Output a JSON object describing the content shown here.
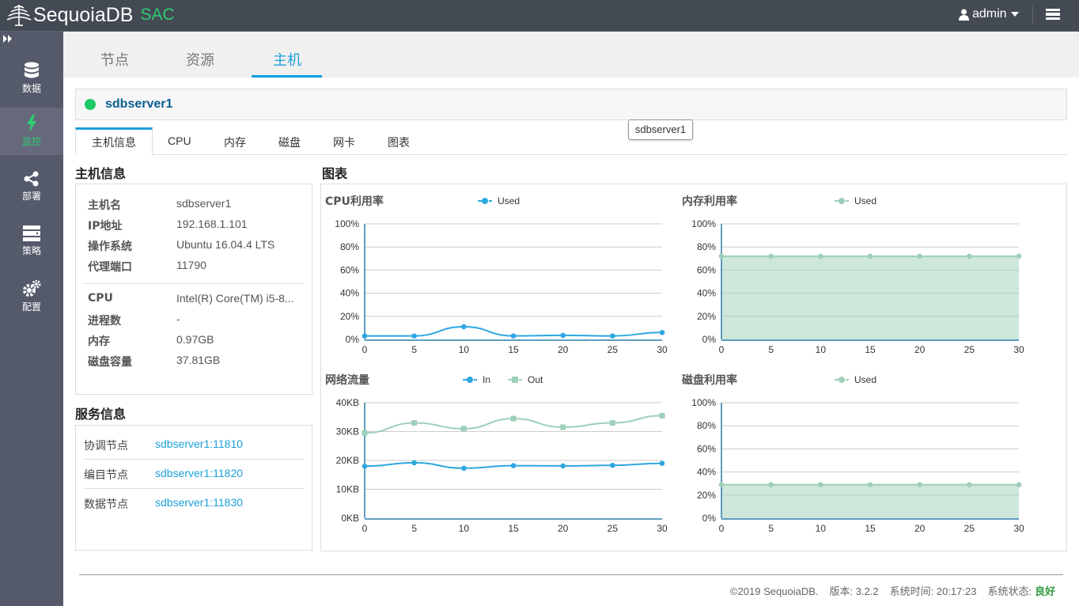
{
  "app": {
    "brand": "SequoiaDB",
    "suffix": "SAC",
    "user": "admin"
  },
  "sidebar": {
    "items": [
      {
        "label": "数据",
        "icon": "database-icon"
      },
      {
        "label": "监控",
        "icon": "bolt-icon"
      },
      {
        "label": "部署",
        "icon": "share-icon"
      },
      {
        "label": "策略",
        "icon": "server-icon"
      },
      {
        "label": "配置",
        "icon": "gears-icon"
      }
    ]
  },
  "page_tabs": [
    "节点",
    "资源",
    "主机"
  ],
  "host": {
    "name": "sdbserver1",
    "tooltip": "sdbserver1",
    "status_color": "#1ec964"
  },
  "sub_tabs": [
    "主机信息",
    "CPU",
    "内存",
    "磁盘",
    "网卡",
    "图表"
  ],
  "host_info": {
    "title": "主机信息",
    "rows1": [
      {
        "k": "主机名",
        "v": "sdbserver1"
      },
      {
        "k": "IP地址",
        "v": "192.168.1.101"
      },
      {
        "k": "操作系统",
        "v": "Ubuntu 16.04.4 LTS"
      },
      {
        "k": "代理端口",
        "v": "11790"
      }
    ],
    "rows2": [
      {
        "k": "CPU",
        "v": "Intel(R) Core(TM) i5-8..."
      },
      {
        "k": "进程数",
        "v": "-"
      },
      {
        "k": "内存",
        "v": "0.97GB"
      },
      {
        "k": "磁盘容量",
        "v": "37.81GB"
      }
    ]
  },
  "service_info": {
    "title": "服务信息",
    "rows": [
      {
        "k": "协调节点",
        "v": "sdbserver1:11810"
      },
      {
        "k": "编目节点",
        "v": "sdbserver1:11820"
      },
      {
        "k": "数据节点",
        "v": "sdbserver1:11830"
      }
    ]
  },
  "charts_title": "图表",
  "chart_data": [
    {
      "type": "line",
      "title": "CPU利用率",
      "x": [
        0,
        5,
        10,
        15,
        20,
        25,
        30
      ],
      "yticks": [
        "0%",
        "20%",
        "40%",
        "60%",
        "80%",
        "100%"
      ],
      "ylim": [
        0,
        100
      ],
      "series": [
        {
          "name": "Used",
          "values": [
            3,
            3,
            11,
            3,
            3.5,
            3,
            6
          ],
          "color": "#2ea7e0",
          "marker": "circle",
          "fill": false
        }
      ]
    },
    {
      "type": "area",
      "title": "内存利用率",
      "x": [
        0,
        5,
        10,
        15,
        20,
        25,
        30
      ],
      "yticks": [
        "0%",
        "20%",
        "40%",
        "60%",
        "80%",
        "100%"
      ],
      "ylim": [
        0,
        100
      ],
      "series": [
        {
          "name": "Used",
          "values": [
            72,
            72,
            72,
            72,
            72,
            72,
            72
          ],
          "color": "#9ecfb8",
          "marker": "circle",
          "fill": true
        }
      ]
    },
    {
      "type": "line",
      "title": "网络流量",
      "x": [
        0,
        5,
        10,
        15,
        20,
        25,
        30
      ],
      "yticks": [
        "0KB",
        "10KB",
        "20KB",
        "30KB",
        "40KB"
      ],
      "ylim": [
        0,
        40
      ],
      "series": [
        {
          "name": "In",
          "values": [
            18,
            19.2,
            17.3,
            18.2,
            18.1,
            18.3,
            19
          ],
          "color": "#2ea7e0",
          "marker": "circle",
          "fill": false
        },
        {
          "name": "Out",
          "values": [
            29.5,
            33,
            31,
            34.5,
            31.5,
            33,
            35.5
          ],
          "color": "#9ecfb8",
          "marker": "square",
          "fill": false
        }
      ]
    },
    {
      "type": "area",
      "title": "磁盘利用率",
      "x": [
        0,
        5,
        10,
        15,
        20,
        25,
        30
      ],
      "yticks": [
        "0%",
        "20%",
        "40%",
        "60%",
        "80%",
        "100%"
      ],
      "ylim": [
        0,
        100
      ],
      "series": [
        {
          "name": "Used",
          "values": [
            29,
            29,
            29,
            29,
            29,
            29,
            29
          ],
          "color": "#9ecfb8",
          "marker": "circle",
          "fill": true
        }
      ]
    }
  ],
  "footer": {
    "copyright": "©2019 SequoiaDB.",
    "version": "版本: 3.2.2",
    "time": "系统时间: 20:17:23",
    "status_label": "系统状态:",
    "status": "良好"
  }
}
